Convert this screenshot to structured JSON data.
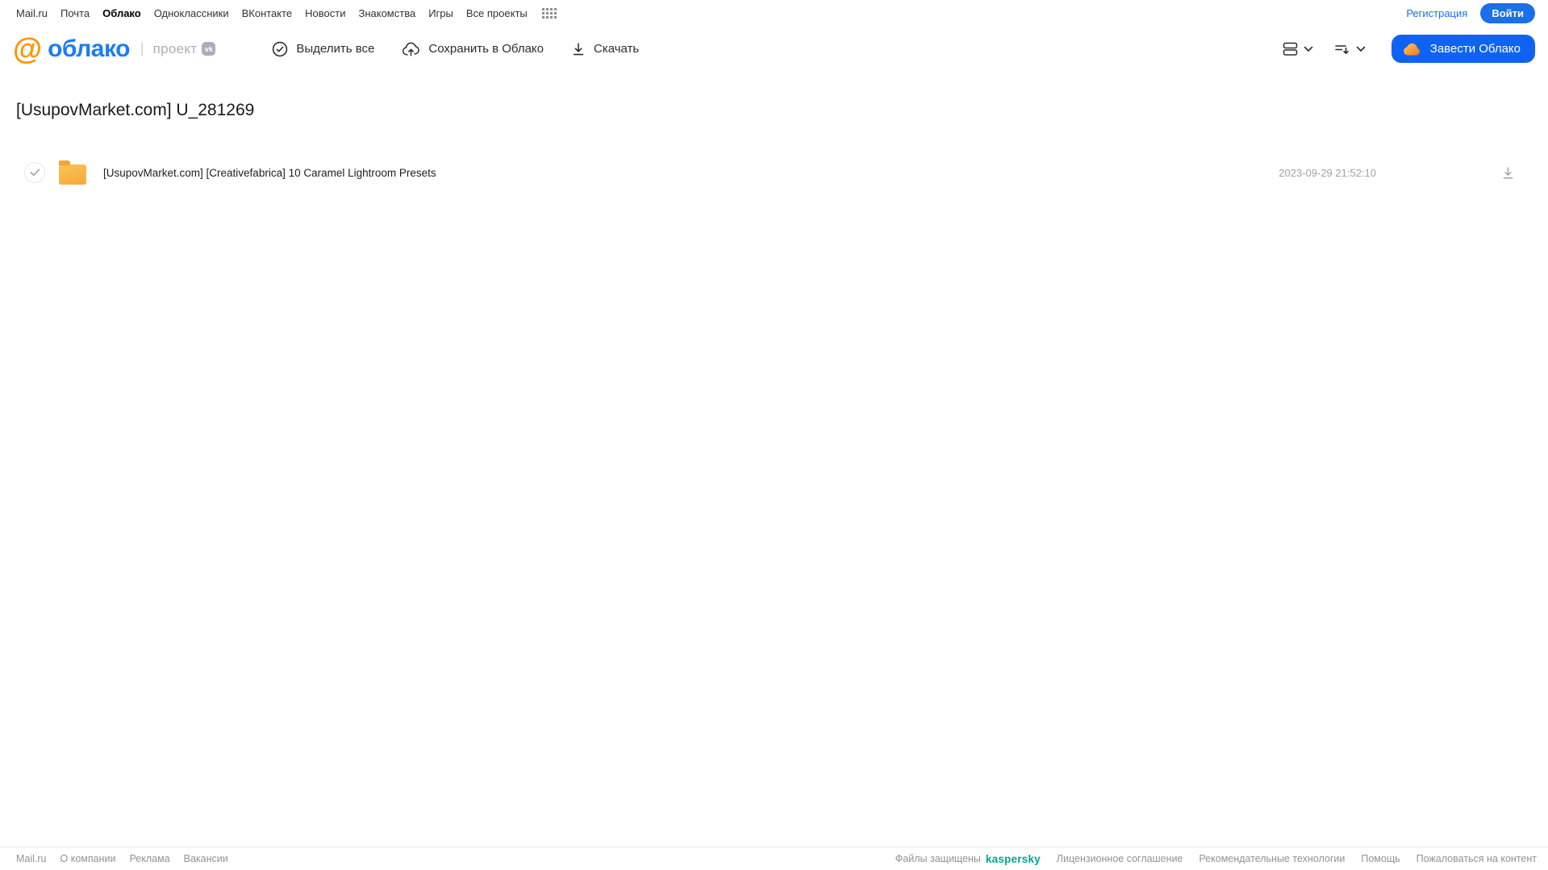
{
  "top_nav": {
    "links": [
      "Mail.ru",
      "Почта",
      "Облако",
      "Одноклассники",
      "ВКонтакте",
      "Новости",
      "Знакомства",
      "Игры",
      "Все проекты"
    ],
    "active_link": "Облако",
    "register_label": "Регистрация",
    "login_label": "Войти"
  },
  "header": {
    "logo_at": "@",
    "logo_text": "облако",
    "project_label": "проект",
    "vk_badge": "vk",
    "toolbar": {
      "select_all_label": "Выделить все",
      "save_to_cloud_label": "Сохранить в Облако",
      "download_label": "Скачать"
    },
    "get_cloud_label": "Завести Облако"
  },
  "page": {
    "title": "[UsupovMarket.com] U_281269"
  },
  "files": [
    {
      "type": "folder",
      "name": "[UsupovMarket.com] [Creativefabrica] 10 Caramel Lightroom Presets",
      "date": "2023-09-29 21:52:10"
    }
  ],
  "footer": {
    "left_links": [
      "Mail.ru",
      "О компании",
      "Реклама",
      "Вакансии"
    ],
    "protected_text": "Файлы защищены",
    "kaspersky_label": "kaspersky",
    "right_links": [
      "Лицензионное соглашение",
      "Рекомендательные технологии",
      "Помощь",
      "Пожаловаться на контент"
    ]
  },
  "colors": {
    "accent_blue": "#0e63f4",
    "logo_blue": "#1b7cf7",
    "logo_orange": "#ff9400",
    "kaspersky_teal": "#00a88e",
    "folder_amber": "#f4a93b"
  },
  "icons": {
    "grid": "grid-dots",
    "select_all": "check-circle",
    "save": "cloud-upload",
    "download": "arrow-down-line",
    "view": "list-view",
    "sort": "sort-lines-arrow",
    "chevron": "chevron-down",
    "cloud": "orange-cloud"
  }
}
